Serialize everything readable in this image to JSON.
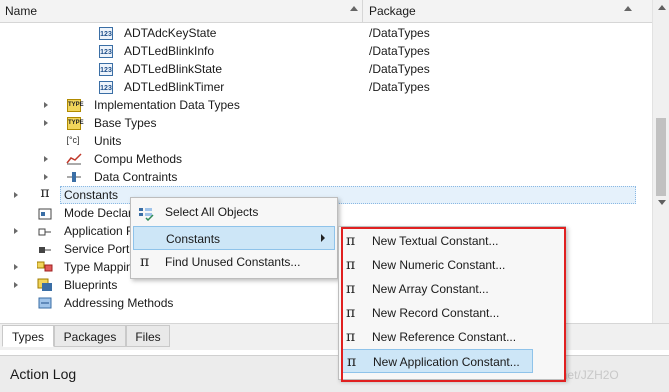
{
  "header": {
    "name_col": "Name",
    "package_col": "Package"
  },
  "tree": {
    "rows": [
      {
        "label": "ADTAdcKeyState",
        "package": "/DataTypes",
        "icon": "123"
      },
      {
        "label": "ADTLedBlinkInfo",
        "package": "/DataTypes",
        "icon": "123"
      },
      {
        "label": "ADTLedBlinkState",
        "package": "/DataTypes",
        "icon": "123"
      },
      {
        "label": "ADTLedBlinkTimer",
        "package": "/DataTypes",
        "icon": "123"
      },
      {
        "label": "Implementation Data Types",
        "icon": "TYPE"
      },
      {
        "label": "Base Types",
        "icon": "TYPE"
      },
      {
        "label": "Units",
        "icon": "[°c]"
      },
      {
        "label": "Compu Methods",
        "icon": "curve"
      },
      {
        "label": "Data Contraints",
        "icon": "bar"
      },
      {
        "label": "Constants",
        "icon": "π"
      },
      {
        "label": "Mode Declar",
        "icon": "mode"
      },
      {
        "label": "Application F",
        "icon": "app"
      },
      {
        "label": "Service Port",
        "icon": "port"
      },
      {
        "label": "Type Mappin",
        "icon": "map"
      },
      {
        "label": "Blueprints",
        "icon": "blueprint"
      },
      {
        "label": "Addressing Methods",
        "icon": "address"
      }
    ]
  },
  "context_menu": {
    "items": [
      {
        "label": "Select All Objects"
      },
      {
        "label": "Constants"
      },
      {
        "label": "Find Unused Constants..."
      }
    ]
  },
  "submenu": {
    "items": [
      {
        "label": "New Textual Constant..."
      },
      {
        "label": "New Numeric Constant..."
      },
      {
        "label": "New Array Constant..."
      },
      {
        "label": "New Record Constant..."
      },
      {
        "label": "New Reference Constant..."
      },
      {
        "label": "New Application Constant..."
      }
    ]
  },
  "tabs": [
    {
      "label": "Types"
    },
    {
      "label": "Packages"
    },
    {
      "label": "Files"
    }
  ],
  "action_log": {
    "title": "Action Log"
  },
  "watermark": "https://blog.csdn.net/JZH2O",
  "colors": {
    "highlight_border": "#e02020",
    "selection_bg": "#e5f1fb",
    "menu_hover": "#cde6f7"
  }
}
